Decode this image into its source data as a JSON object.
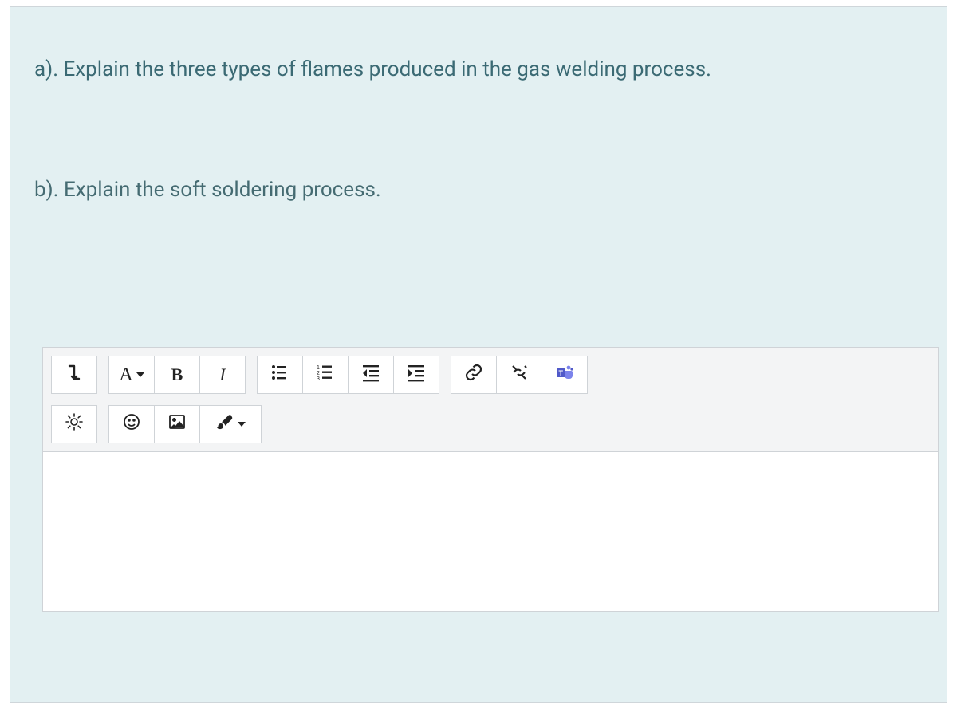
{
  "questions": {
    "a": "a). Explain the three types of flames produced in the gas welding process.",
    "b": "b). Explain the soft soldering process."
  },
  "toolbar": {
    "row1": {
      "expand": {
        "name": "expand-toolbar-button",
        "icon": "expand-icon"
      },
      "font": {
        "name": "font-color-button",
        "label": "A",
        "hasDropdown": true
      },
      "bold": {
        "name": "bold-button",
        "label": "B"
      },
      "italic": {
        "name": "italic-button",
        "label": "I"
      },
      "ul": {
        "name": "bullet-list-button",
        "icon": "bullet-list-icon"
      },
      "ol": {
        "name": "number-list-button",
        "icon": "number-list-icon"
      },
      "outdent": {
        "name": "decrease-indent-button",
        "icon": "outdent-icon"
      },
      "indent": {
        "name": "increase-indent-button",
        "icon": "indent-icon"
      },
      "link": {
        "name": "insert-link-button",
        "icon": "link-icon"
      },
      "unlink": {
        "name": "remove-link-button",
        "icon": "unlink-icon"
      },
      "teams": {
        "name": "teams-button",
        "icon": "teams-icon"
      }
    },
    "row2": {
      "math": {
        "name": "math-button",
        "icon": "sun-icon"
      },
      "emoji": {
        "name": "emoji-button",
        "icon": "smile-icon"
      },
      "image": {
        "name": "insert-image-button",
        "icon": "image-icon"
      },
      "draw": {
        "name": "draw-button",
        "icon": "brush-icon",
        "hasDropdown": true
      }
    }
  },
  "editor": {
    "content": ""
  }
}
